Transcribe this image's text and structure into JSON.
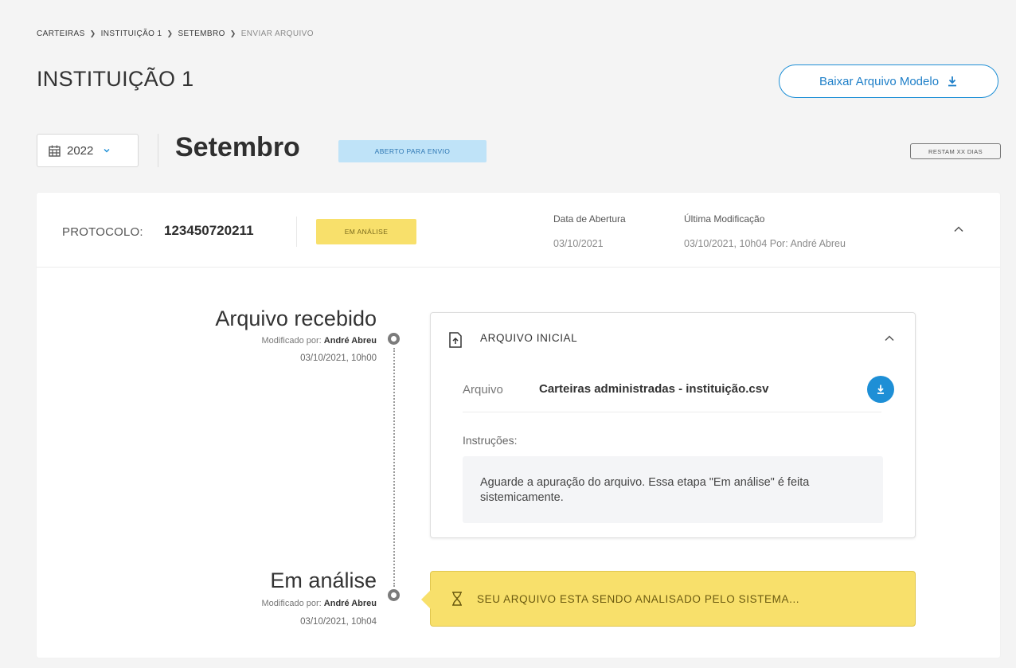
{
  "breadcrumb": {
    "items": [
      "CARTEIRAS",
      "INSTITUIÇÃO 1",
      "SETEMBRO"
    ],
    "current": "ENVIAR ARQUIVO",
    "separator": "❯"
  },
  "page_title": "INSTITUIÇÃO 1",
  "download_model_button": {
    "label": "Baixar Arquivo Modelo",
    "icon": "download-icon"
  },
  "period": {
    "year": "2022",
    "month": "Setembro",
    "status": "ABERTO PARA ENVIO",
    "days_left": "RESTAM XX DIAS"
  },
  "protocol": {
    "label": "PROTOCOLO:",
    "number": "123450720211",
    "status": "EM ANÁLISE",
    "opening_date_label": "Data de Abertura",
    "opening_date": "03/10/2021",
    "last_modified_label": "Última Modificação",
    "last_modified": "03/10/2021, 10h04 Por: André Abreu"
  },
  "timeline": [
    {
      "title": "Arquivo recebido",
      "modified_by_label": "Modificado por:",
      "modified_by": "André Abreu",
      "datetime": "03/10/2021, 10h00"
    },
    {
      "title": "Em análise",
      "modified_by_label": "Modificado por:",
      "modified_by": "André Abreu",
      "datetime": "03/10/2021, 10h04"
    }
  ],
  "file_card": {
    "title": "ARQUIVO INICIAL",
    "file_label": "Arquivo",
    "file_name": "Carteiras administradas -  instituição.csv",
    "instructions_label": "Instruções:",
    "instructions_text": "Aguarde a apuração do arquivo. Essa etapa \"Em análise\" é feita sistemicamente."
  },
  "analysis_banner": {
    "text": "SEU ARQUIVO ESTA SENDO ANALISADO PELO SISTEMA...",
    "icon": "hourglass-icon"
  },
  "colors": {
    "accent_blue": "#1e8fd6",
    "status_open_bg": "#bfe3f8",
    "status_analysis_bg": "#f8e06b"
  }
}
